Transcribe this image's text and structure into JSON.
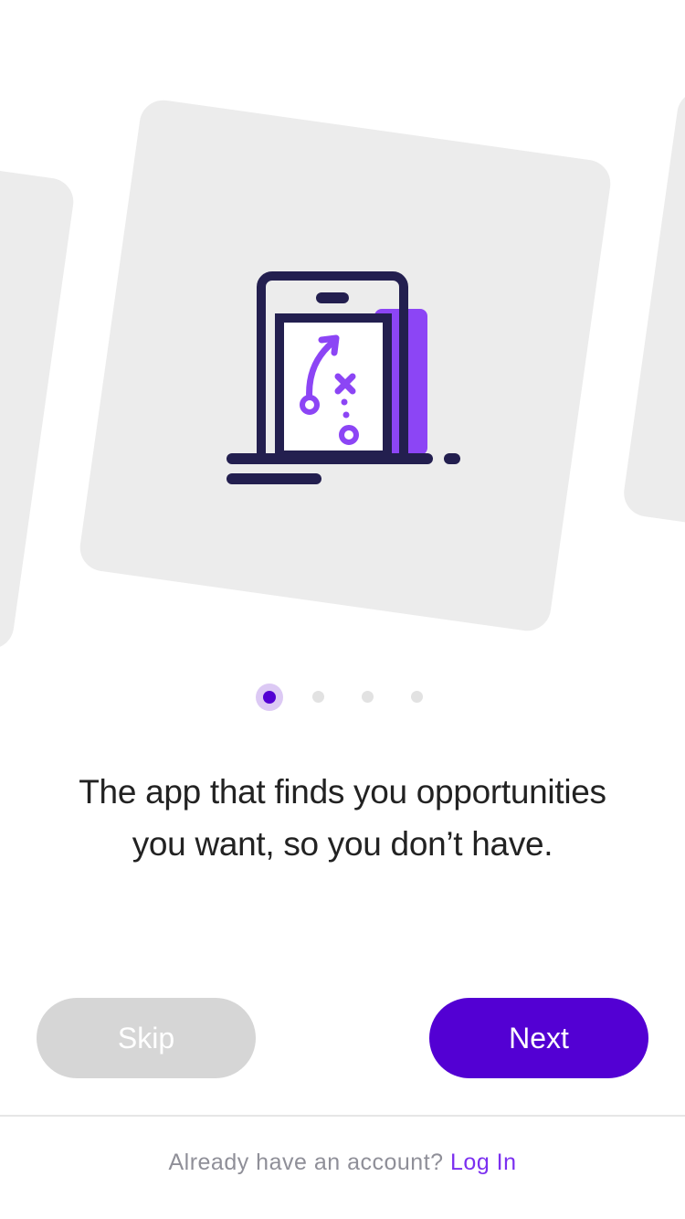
{
  "onboarding": {
    "tagline_line1": "The app that finds you opportunities",
    "tagline_line2": "you want, so you don’t have.",
    "illustration_icon": "laptop-playbook-icon",
    "pagination": {
      "total": 4,
      "current": 1
    }
  },
  "actions": {
    "skip_label": "Skip",
    "next_label": "Next"
  },
  "footer": {
    "prompt": "Already have an account?",
    "login_label": "Log In"
  },
  "colors": {
    "accent": "#5300d3",
    "accent_light": "#8c45f5",
    "dark": "#231f4f",
    "card": "#ececec",
    "skip_bg": "#d6d6d6"
  }
}
